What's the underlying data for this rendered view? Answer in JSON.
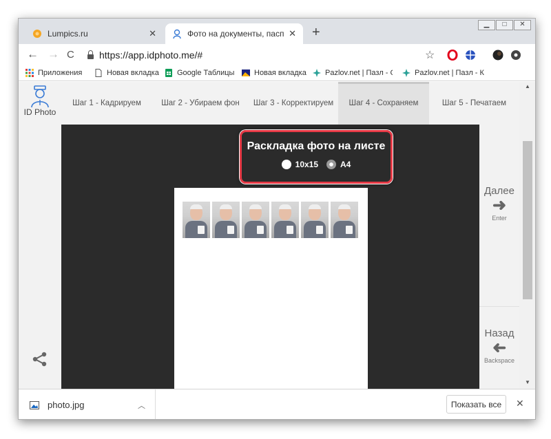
{
  "tabs": [
    {
      "label": "Lumpics.ru",
      "icon": "orange-flower-icon",
      "active": false
    },
    {
      "label": "Фото на документы, паспорта, ",
      "icon": "id-photo-icon",
      "active": true
    }
  ],
  "toolbar": {
    "url": "https://app.idphoto.me/#"
  },
  "bookmarks": [
    {
      "label": "Приложения",
      "icon": "apps-grid-icon"
    },
    {
      "label": "Новая вкладка",
      "icon": "page-icon"
    },
    {
      "label": "Google Таблицы",
      "icon": "sheets-icon"
    },
    {
      "label": "Новая вкладка",
      "icon": "image-icon"
    },
    {
      "label": "Pazlov.net | Пазл - С",
      "icon": "puzzle-icon"
    },
    {
      "label": "Pazlov.net | Пазл - К",
      "icon": "puzzle-icon"
    }
  ],
  "app": {
    "logo_label": "ID Photo",
    "steps": [
      {
        "label": "Шаг 1 - Кадрируем",
        "active": false
      },
      {
        "label": "Шаг 2 - Убираем фон",
        "active": false
      },
      {
        "label": "Шаг 3 - Корректируем",
        "active": false
      },
      {
        "label": "Шаг 4 - Сохраняем",
        "active": true
      },
      {
        "label": "Шаг 5 - Печатаем",
        "active": false
      }
    ],
    "layout_title": "Раскладка фото на листе",
    "options": [
      {
        "label": "10x15",
        "selected": false
      },
      {
        "label": "A4",
        "selected": true
      }
    ],
    "photo_count": 6,
    "next": {
      "label": "Далее",
      "hint": "Enter"
    },
    "back": {
      "label": "Назад",
      "hint": "Backspace"
    }
  },
  "downloads": {
    "file": "photo.jpg",
    "show_all": "Показать все"
  },
  "colors": {
    "highlight": "#e53945",
    "canvas": "#2b2b2b",
    "accent": "#3a7bd5"
  }
}
